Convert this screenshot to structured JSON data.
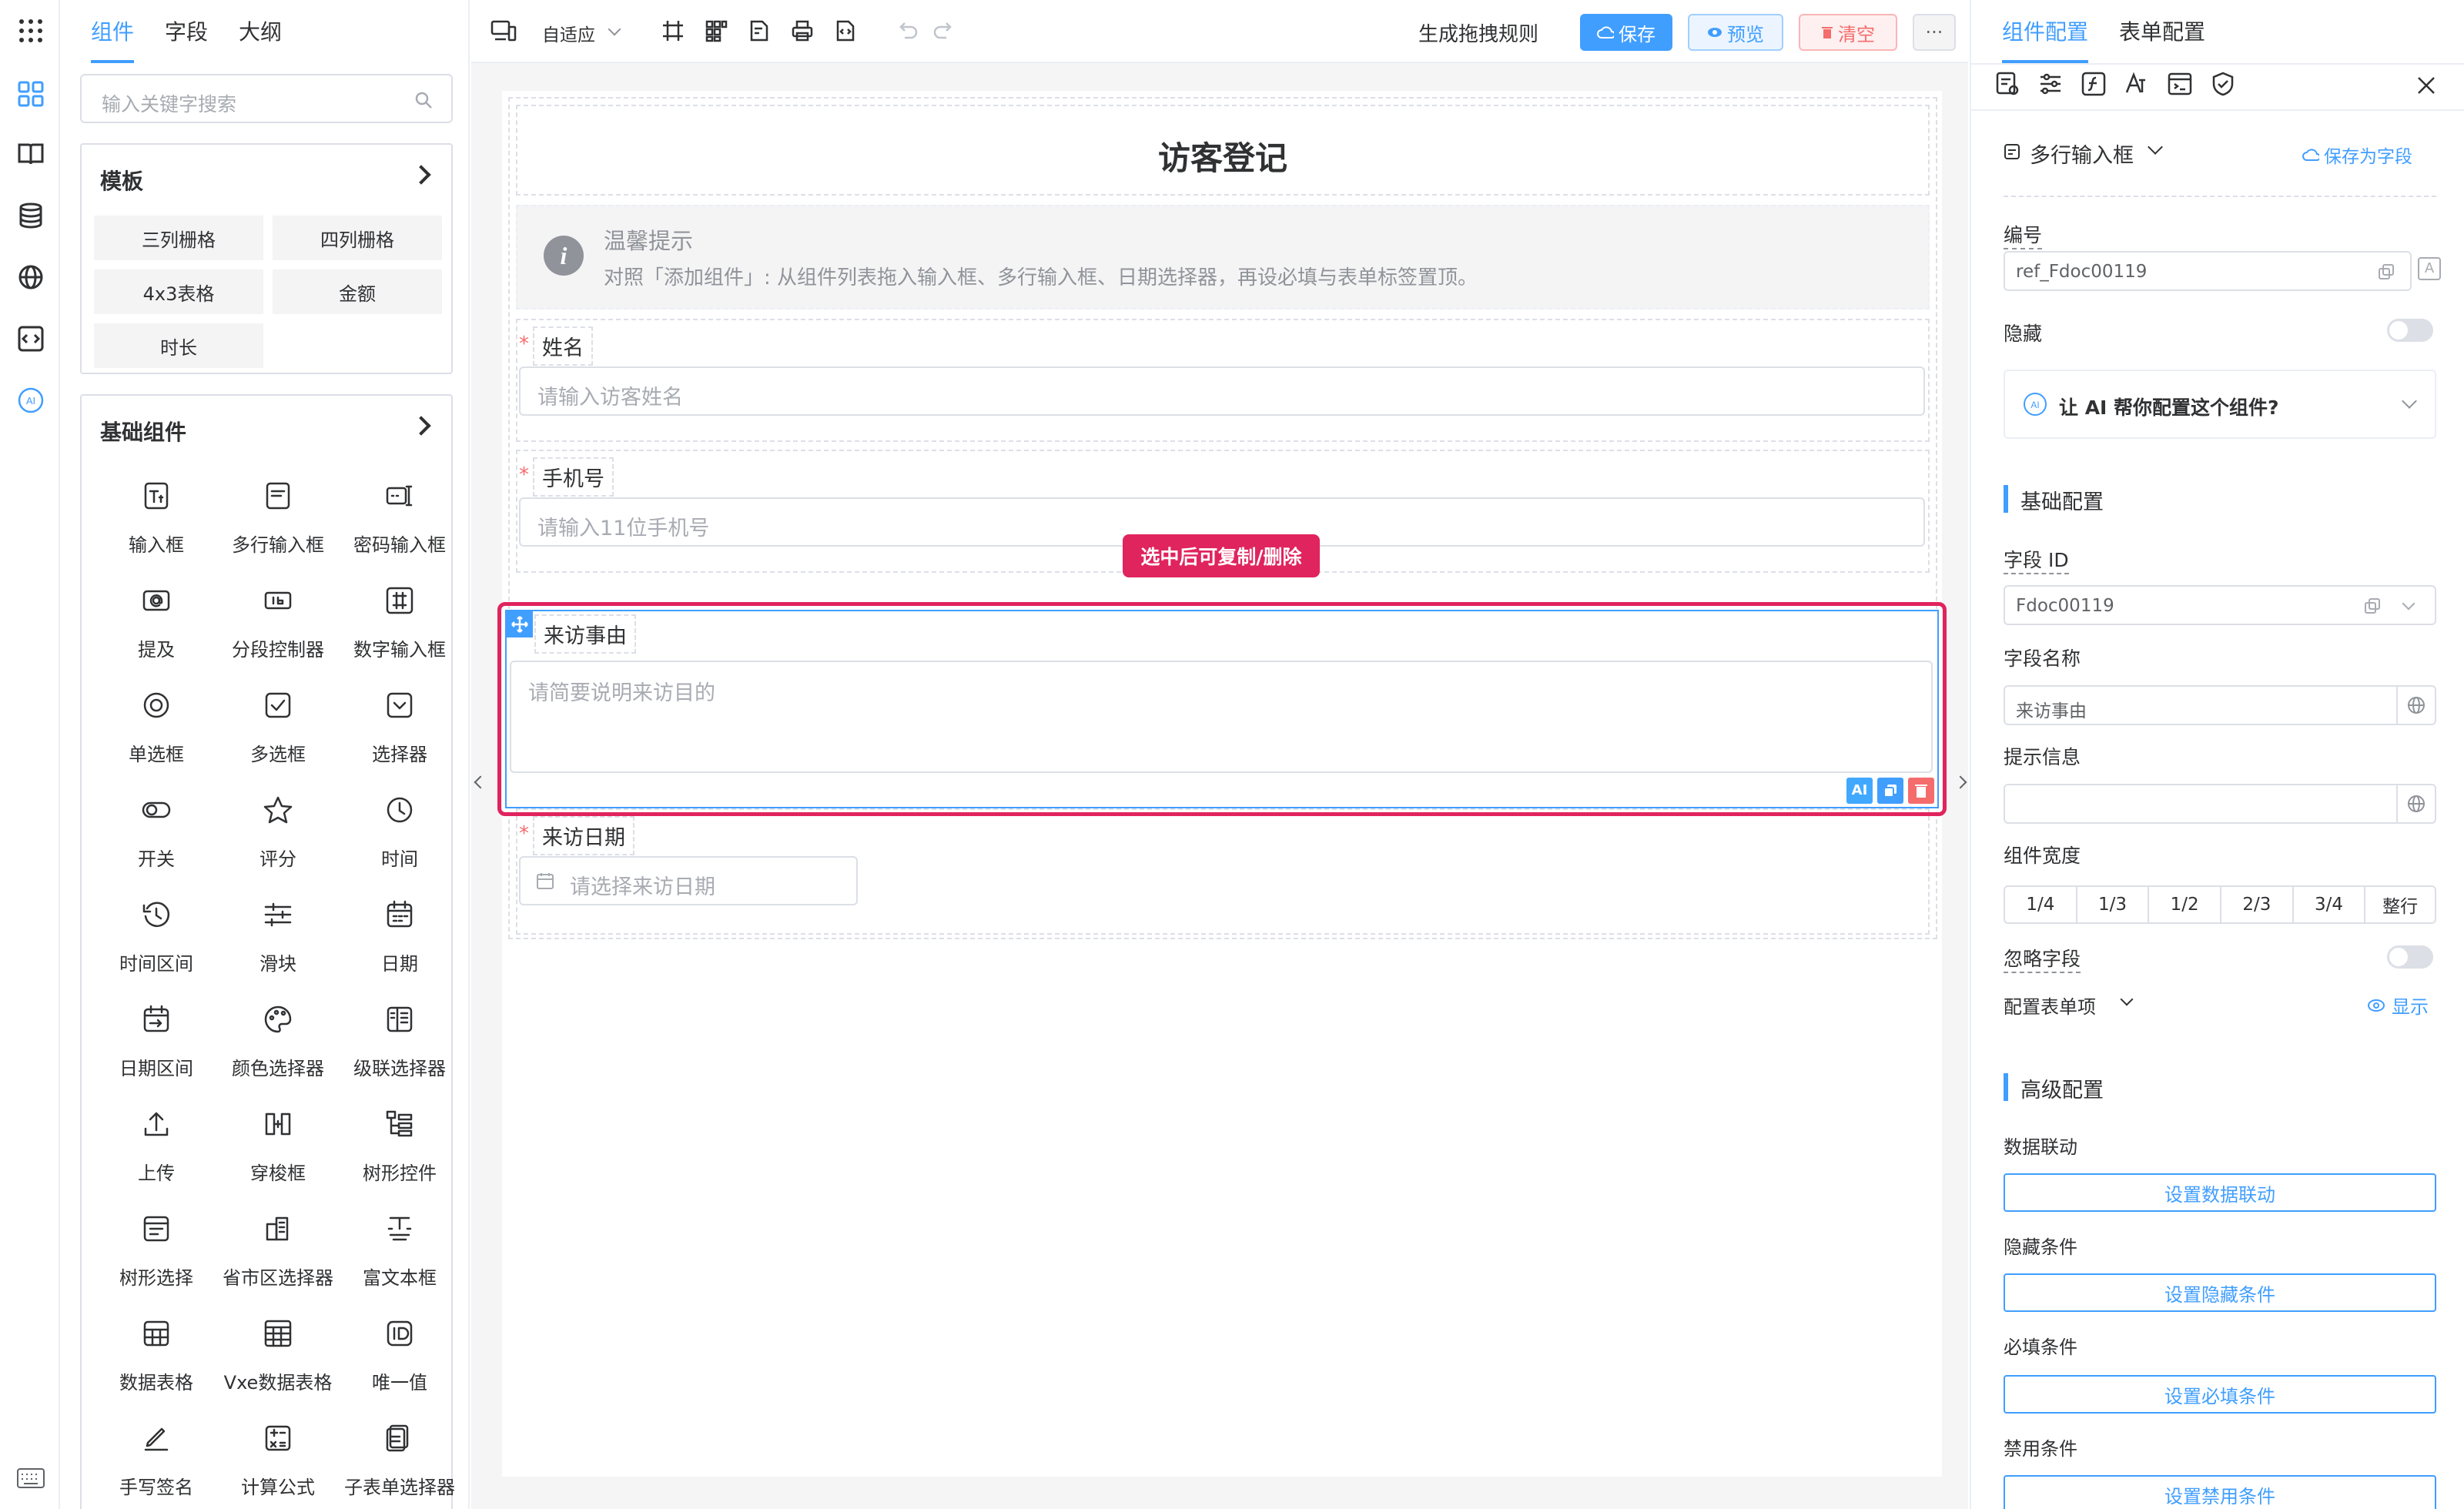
{
  "left_tabs": [
    "组件",
    "字段",
    "大纲"
  ],
  "search": {
    "placeholder": "输入关键字搜索"
  },
  "templates": {
    "title": "模板",
    "items": [
      "三列栅格",
      "四列栅格",
      "4x3表格",
      "金额",
      "时长"
    ]
  },
  "basic": {
    "title": "基础组件",
    "items": [
      "输入框",
      "多行输入框",
      "密码输入框",
      "提及",
      "分段控制器",
      "数字输入框",
      "单选框",
      "多选框",
      "选择器",
      "开关",
      "评分",
      "时间",
      "时间区间",
      "滑块",
      "日期",
      "日期区间",
      "颜色选择器",
      "级联选择器",
      "上传",
      "穿梭框",
      "树形控件",
      "树形选择",
      "省市区选择器",
      "富文本框",
      "数据表格",
      "Vxe数据表格",
      "唯一值",
      "手写签名",
      "计算公式",
      "子表单选择器"
    ]
  },
  "toolbar": {
    "device": "自适应",
    "generate": "生成拖拽规则",
    "save": "保存",
    "preview": "预览",
    "clear": "清空",
    "more": "···"
  },
  "form": {
    "title": "访客登记",
    "alert_title": "温馨提示",
    "alert_desc": "对照「添加组件」: 从组件列表拖入输入框、多行输入框、日期选择器，再设必填与表单标签置顶。",
    "name_label": "姓名",
    "name_ph": "请输入访客姓名",
    "phone_label": "手机号",
    "phone_ph": "请输入11位手机号",
    "reason_label": "来访事由",
    "reason_ph": "请简要说明来访目的",
    "date_label": "来访日期",
    "date_ph": "请选择来访日期",
    "tooltip": "选中后可复制/删除"
  },
  "right": {
    "tabs": [
      "组件配置",
      "表单配置"
    ],
    "type": "多行输入框",
    "save_field": "保存为字段",
    "ref_label": "编号",
    "ref_value": "ref_Fdoc00119",
    "hidden_label": "隐藏",
    "ai": "让 AI 帮你配置这个组件?",
    "basic_title": "基础配置",
    "field_id_label": "字段 ID",
    "field_id_value": "Fdoc00119",
    "field_name_label": "字段名称",
    "field_name_value": "来访事由",
    "hint_label": "提示信息",
    "width_label": "组件宽度",
    "widths": [
      "1/4",
      "1/3",
      "1/2",
      "2/3",
      "3/4",
      "整行"
    ],
    "ignore_label": "忽略字段",
    "form_item_label": "配置表单项",
    "show": "显示",
    "adv_title": "高级配置",
    "link_label": "数据联动",
    "link_btn": "设置数据联动",
    "hide_cond_label": "隐藏条件",
    "hide_cond_btn": "设置隐藏条件",
    "req_cond_label": "必填条件",
    "req_cond_btn": "设置必填条件",
    "dis_cond_label": "禁用条件",
    "dis_cond_btn": "设置禁用条件"
  },
  "colors": {
    "primary": "#409eff",
    "danger": "#f56c6c",
    "selected": "#e0245e"
  }
}
